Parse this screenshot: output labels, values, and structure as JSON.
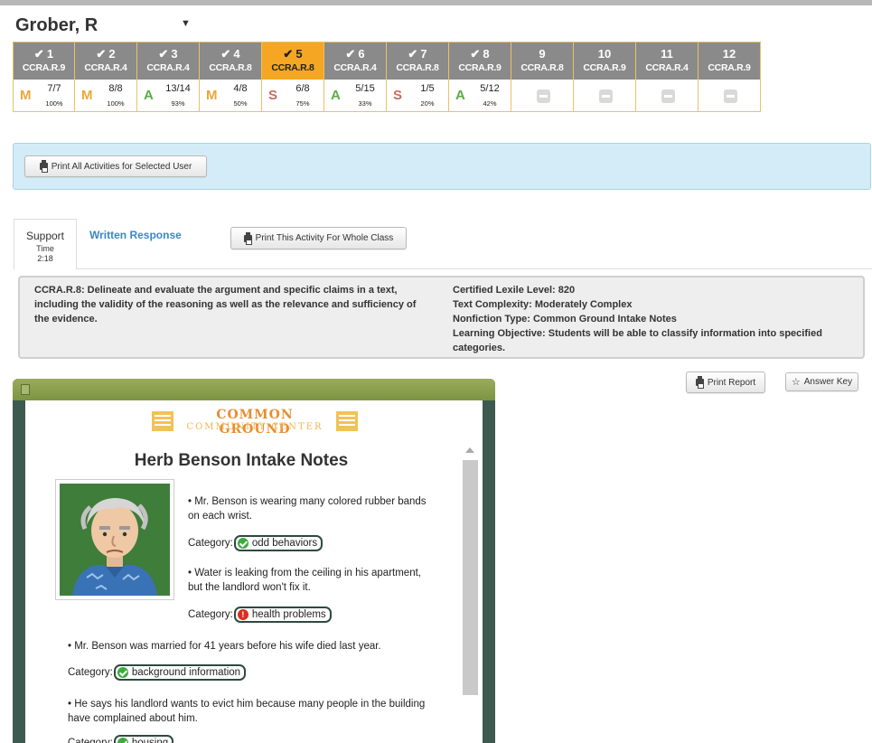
{
  "student": {
    "name": "Grober, R"
  },
  "activities": [
    {
      "num": "1",
      "done": "✔",
      "standard": "CCRA.R.9",
      "grade": "M",
      "score": "7/7",
      "pct": "100%"
    },
    {
      "num": "2",
      "done": "✔",
      "standard": "CCRA.R.4",
      "grade": "M",
      "score": "8/8",
      "pct": "100%"
    },
    {
      "num": "3",
      "done": "✔",
      "standard": "CCRA.R.4",
      "grade": "A",
      "score": "13/14",
      "pct": "93%"
    },
    {
      "num": "4",
      "done": "✔",
      "standard": "CCRA.R.8",
      "grade": "M",
      "score": "4/8",
      "pct": "50%"
    },
    {
      "num": "5",
      "done": "✔",
      "standard": "CCRA.R.8",
      "grade": "S",
      "score": "6/8",
      "pct": "75%"
    },
    {
      "num": "6",
      "done": "✔",
      "standard": "CCRA.R.4",
      "grade": "A",
      "score": "5/15",
      "pct": "33%"
    },
    {
      "num": "7",
      "done": "✔",
      "standard": "CCRA.R.8",
      "grade": "S",
      "score": "1/5",
      "pct": "20%"
    },
    {
      "num": "8",
      "done": "✔",
      "standard": "CCRA.R.9",
      "grade": "A",
      "score": "5/12",
      "pct": "42%"
    },
    {
      "num": "9",
      "done": "",
      "standard": "CCRA.R.8"
    },
    {
      "num": "10",
      "done": "",
      "standard": "CCRA.R.9"
    },
    {
      "num": "11",
      "done": "",
      "standard": "CCRA.R.4"
    },
    {
      "num": "12",
      "done": "",
      "standard": "CCRA.R.9"
    }
  ],
  "buttons": {
    "print_all": "Print All Activities for Selected User",
    "print_class": "Print This Activity For Whole Class",
    "print_report": "Print Report",
    "answer_key": "Answer Key"
  },
  "tabs": {
    "support": {
      "label": "Support",
      "time_label": "Time",
      "time_value": "2:18"
    },
    "written": "Written Response"
  },
  "standard": {
    "description": "CCRA.R.8: Delineate and evaluate the argument and specific claims in a text, including the validity of the reasoning as well as the relevance and sufficiency of the evidence.",
    "lexile": "Certified Lexile Level: 820",
    "complexity": "Text Complexity: Moderately Complex",
    "nonfiction": "Nonfiction Type: Common Ground Intake Notes",
    "objective": "Learning Objective: Students will be able to classify information into specified categories."
  },
  "document": {
    "logo_line1": "COMMON GROUND",
    "logo_line2": "COMMUNITY CENTER",
    "title": "Herb Benson Intake Notes",
    "category_label": "Category:",
    "notes": [
      {
        "text": "• Mr. Benson is wearing many colored rubber bands on each wrist.",
        "answer": "odd behaviors",
        "status": "correct"
      },
      {
        "text": "• Water is leaking from the ceiling in his apartment, but the landlord won't fix it.",
        "answer": "health problems",
        "status": "incorrect"
      },
      {
        "text": "• Mr. Benson was married for 41 years before his wife died last year.",
        "answer": "background information",
        "status": "correct"
      },
      {
        "text": "• He says his landlord wants to evict him because many people in the building have complained about him.",
        "answer": "housing",
        "status": "correct"
      }
    ]
  },
  "colors": {
    "accent_current": "#f5a623",
    "header_gray": "#8a8a8a",
    "grade_M": "#e8a83a",
    "grade_A": "#5bab45",
    "grade_S": "#c96b5c",
    "info_band": "#d4ecf7",
    "link": "#3a87c8",
    "viewer_frame": "#3c5a50",
    "correct": "#3cab3c",
    "incorrect": "#d9301f"
  }
}
